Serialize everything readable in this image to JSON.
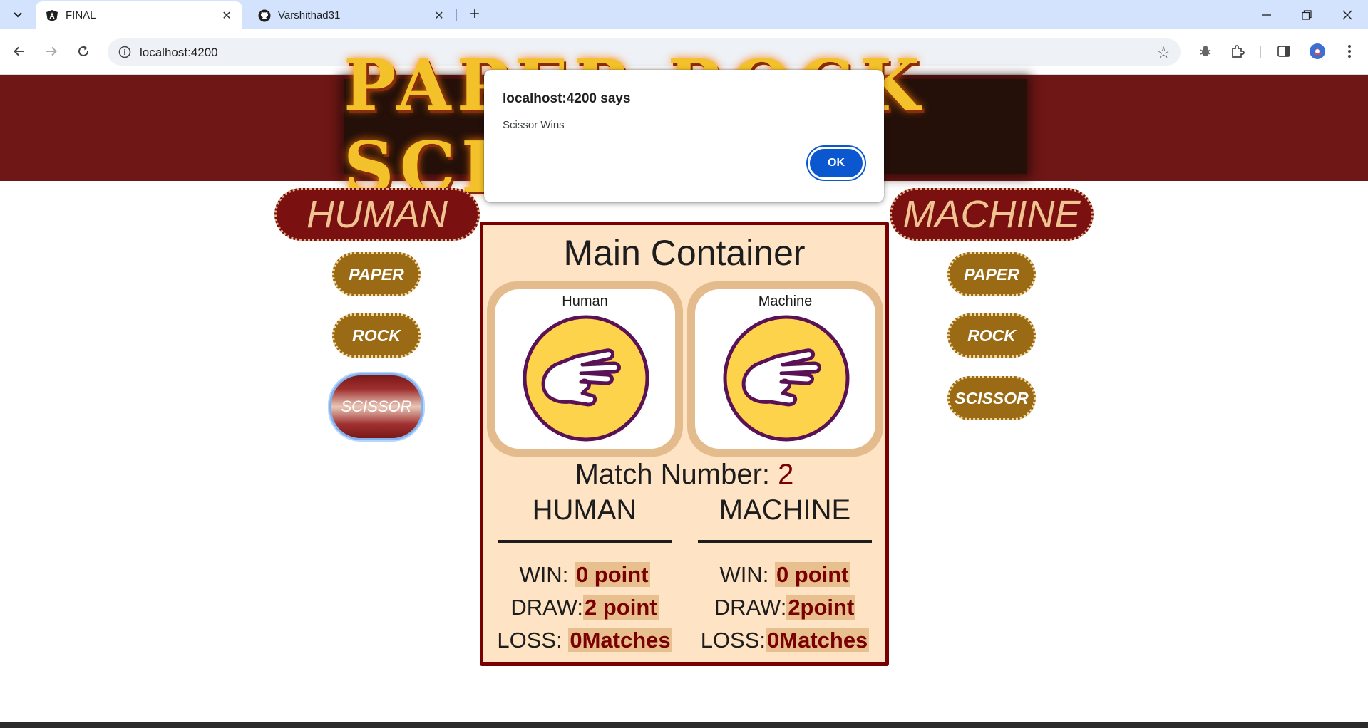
{
  "browser": {
    "tabs": [
      {
        "title": "FINAL",
        "icon": "angular-icon",
        "active": true
      },
      {
        "title": "Varshithad31",
        "icon": "github-icon",
        "active": false
      }
    ],
    "url": "localhost:4200"
  },
  "page": {
    "banner_text": "PAPER ROCK SCISSOR",
    "human_title": "HUMAN",
    "machine_title": "MACHINE",
    "human_moves": [
      "PAPER",
      "ROCK",
      "SCISSOR"
    ],
    "machine_moves": [
      "PAPER",
      "ROCK",
      "SCISSOR"
    ],
    "selected_human_move": "SCISSOR",
    "main": {
      "title": "Main Container",
      "human_card_label": "Human",
      "machine_card_label": "Machine",
      "human_hand": "scissor-hand-icon",
      "machine_hand": "scissor-hand-icon",
      "match_label": "Match Number:",
      "match_number": "2",
      "human_header": "HUMAN",
      "machine_header": "MACHINE",
      "human_scores": {
        "win_label": "WIN:",
        "win": "0 point",
        "draw_label": "DRAW:",
        "draw": "2 point",
        "loss_label": "LOSS:",
        "loss": "0Matches"
      },
      "machine_scores": {
        "win_label": "WIN:",
        "win": "0 point",
        "draw_label": "DRAW:",
        "draw": "2point",
        "loss_label": "LOSS:",
        "loss": "0Matches"
      }
    }
  },
  "dialog": {
    "title": "localhost:4200 says",
    "message": "Scissor Wins",
    "ok_label": "OK"
  },
  "colors": {
    "banner": "#6f1616",
    "title_pill": "#7b1010",
    "move_button": "#9b6a14",
    "main_border": "#790000",
    "main_bg": "#fee3c5",
    "hand_circle": "#fdd34c",
    "hand_outline": "#5b1155",
    "dialog_button": "#0b57d0"
  }
}
